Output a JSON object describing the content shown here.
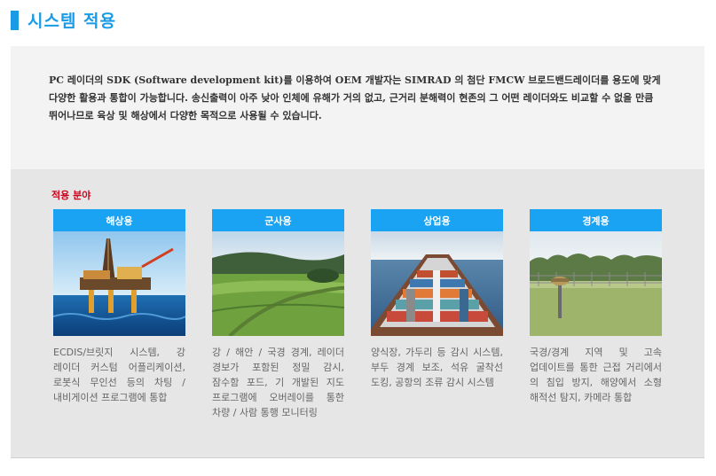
{
  "header": {
    "title": "시스템 적용"
  },
  "intro": {
    "text": "PC 레이더의 SDK (Software development kit)를 이용하여 OEM 개발자는 SIMRAD 의 첨단 FMCW 브로드밴드레이더를 용도에 맞게 다양한 활용과 통합이 가능합니다. 송신출력이 아주 낮아 인체에 유해가 거의 없고, 근거리 분해력이 현존의 그 어떤 레이더와도 비교할 수 없을 만큼 뛰어나므로 육상 및 해상에서 다양한 목적으로 사용될 수 있습니다."
  },
  "applications": {
    "label": "적용 분야",
    "cards": [
      {
        "title": "해상용",
        "description": "ECDIS/브릿지 시스템, 강 레이더 커스텀 어플리케이션, 로봇식 무인선 등의 차팅 / 내비게이션 프로그램에 통합"
      },
      {
        "title": "군사용",
        "description": "강 / 해안 / 국경 경계, 레이더 경보가 포함된 정밀 감시, 잠수함 포드, 기 개발된 지도 프로그램에 오버레이를 통한 차량 / 사람 통행 모니터링"
      },
      {
        "title": "상업용",
        "description": "양식장, 가두리 등 감시 시스템, 부두 경계 보조, 석유 굴착선 도킹, 공항의 조류 감시 시스템"
      },
      {
        "title": "경계용",
        "description": "국경/경계 지역 및 고속 업데이트를 통한 근접 거리에서 의 침입 방지, 해양에서 소형 해적선 탐지, 카메라 통합"
      }
    ]
  },
  "colors": {
    "accent": "#1a9be6",
    "card_header": "#1aa3f2",
    "label_red": "#d0021b"
  }
}
